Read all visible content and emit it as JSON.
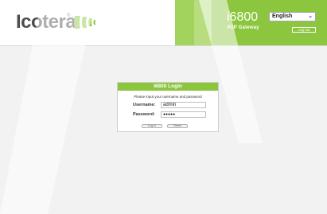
{
  "header": {
    "logo_text": "Icotera",
    "logo_registered": "®",
    "product_name": "i6800",
    "product_subtitle": "P2P Gateway",
    "language": "English",
    "logout_label": "Log out",
    "brand_color": "#8cc63f"
  },
  "login": {
    "title": "i6800 Login",
    "prompt": "Please input your username and password",
    "username_label": "Username:",
    "username_value": "admin",
    "password_label": "Password:",
    "password_value": "●●●●●",
    "login_button": "Log in",
    "reset_button": "Reset"
  }
}
